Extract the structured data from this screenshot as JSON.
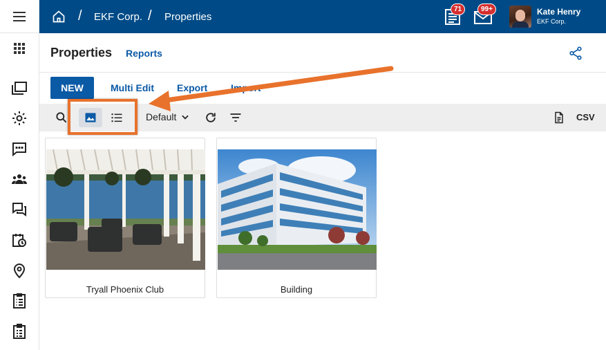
{
  "breadcrumb": {
    "items": [
      "EKF Corp.",
      "Properties"
    ],
    "separator": "/"
  },
  "notifications": {
    "tasks_badge": "71",
    "mail_badge": "99+"
  },
  "user": {
    "name": "Kate Henry",
    "org": "EKF Corp."
  },
  "page": {
    "title": "Properties",
    "tab_reports": "Reports"
  },
  "actions": {
    "new": "NEW",
    "multi_edit": "Multi Edit",
    "export": "Export",
    "import": "Import"
  },
  "toolbar": {
    "sort_default": "Default",
    "csv": "CSV"
  },
  "cards": [
    {
      "caption": "Tryall Phoenix Club"
    },
    {
      "caption": "Building"
    }
  ],
  "colors": {
    "brand": "#004b87",
    "accent": "#0b5aa6",
    "highlight": "#e8722c",
    "badge": "#d62f2f"
  },
  "icons": {
    "rail": [
      "hamburger-icon",
      "apps-grid-icon",
      "folders-icon",
      "gear-icon",
      "chat-icon",
      "people-icon",
      "forum-icon",
      "calendar-clock-icon",
      "location-pin-icon",
      "checklist-icon",
      "clipboard-list-icon"
    ],
    "toolbar": [
      "search-icon",
      "image-view-icon",
      "list-view-icon",
      "chevron-down-icon",
      "refresh-icon",
      "filter-icon",
      "document-icon"
    ]
  }
}
